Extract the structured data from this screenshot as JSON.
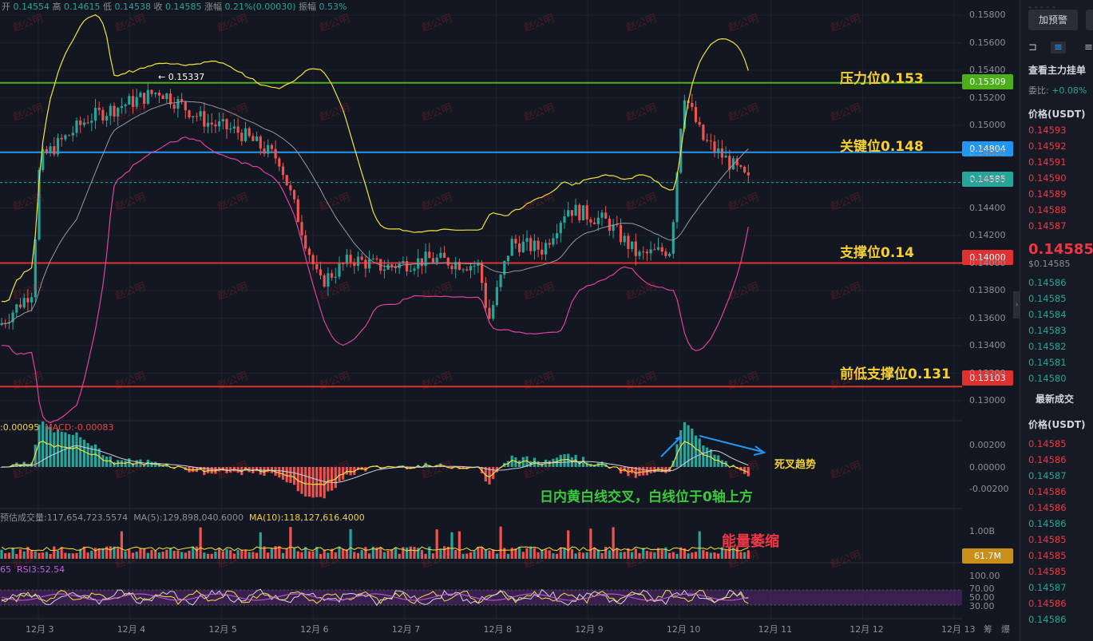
{
  "header": {
    "open_label": "开",
    "open": "0.14554",
    "high_label": "高",
    "high": "0.14615",
    "low_label": "低",
    "low": "0.14538",
    "close_label": "收",
    "close": "0.14585",
    "change_label": "涨幅",
    "change": "0.21%(0.00030)",
    "amp_label": "振幅",
    "amp": "0.53%"
  },
  "price_axis": [
    "0.15800",
    "0.15600",
    "0.15400",
    "0.15200",
    "0.15000",
    "0.14800",
    "0.14600",
    "0.14400",
    "0.14200",
    "0.14000",
    "0.13800",
    "0.13600",
    "0.13400",
    "0.13200",
    "0.13000"
  ],
  "levels": [
    {
      "label": "压力位0.153",
      "tag": "0.15309",
      "color": "#4caf1a"
    },
    {
      "label": "关键位0.148",
      "tag": "0.14804",
      "color": "#2196f3"
    },
    {
      "label": "支撑位0.14",
      "tag": "0.14000",
      "color": "#e03030"
    },
    {
      "label": "前低支撑位0.131",
      "tag": "0.13103",
      "color": "#e03030"
    }
  ],
  "current_tag": "0.14585",
  "high_marker": "← 0.15337",
  "macd": {
    "legend_a": ":0.00095",
    "legend_b": "MACD:-0.00083",
    "axis": [
      "0.00200",
      "0.00000",
      "-0.00200"
    ],
    "annotation": "日内黄白线交叉，白线位于0轴上方",
    "trend_label": "死叉趋势"
  },
  "volume": {
    "legend_a": "预估成交量:117,654,723.5574",
    "legend_b": "MA(5):129,898,040.6000",
    "legend_c": "MA(10):118,127,616.4000",
    "axis_top": "1.00B",
    "tag": "61.7M",
    "annotation": "能量萎缩"
  },
  "rsi": {
    "legend_a": "65",
    "legend_b": "RSI3:52.54",
    "axis": [
      "100.00",
      "70.00",
      "50.00",
      "30.00"
    ]
  },
  "x_axis": [
    "12月 3",
    "12月 4",
    "12月 5",
    "12月 6",
    "12月 7",
    "12月 8",
    "12月 9",
    "12月 10",
    "12月 11",
    "12月 12",
    "12月 13"
  ],
  "x_corner": [
    "筹",
    "爆"
  ],
  "watermark": "赵公明",
  "panel": {
    "dash": "- - - - -",
    "alert_button": "加预警",
    "view_orders": "查看主力挂单",
    "ratio_label": "委比:",
    "ratio": "+0.08%",
    "price_header": "价格(USDT)",
    "asks": [
      "0.14593",
      "0.14592",
      "0.14591",
      "0.14590",
      "0.14589",
      "0.14588",
      "0.14587"
    ],
    "last_price": "0.14585",
    "last_sub": "$0.14585",
    "bids": [
      "0.14586",
      "0.14585",
      "0.14584",
      "0.14583",
      "0.14582",
      "0.14581",
      "0.14580"
    ],
    "trades_title": "最新成交",
    "trades_header": "价格(USDT)",
    "trades": [
      {
        "p": "0.14585",
        "c": "r"
      },
      {
        "p": "0.14586",
        "c": "r"
      },
      {
        "p": "0.14587",
        "c": "g"
      },
      {
        "p": "0.14586",
        "c": "r"
      },
      {
        "p": "0.14586",
        "c": "r"
      },
      {
        "p": "0.14586",
        "c": "g"
      },
      {
        "p": "0.14585",
        "c": "r"
      },
      {
        "p": "0.14585",
        "c": "r"
      },
      {
        "p": "0.14585",
        "c": "r"
      },
      {
        "p": "0.14587",
        "c": "g"
      },
      {
        "p": "0.14586",
        "c": "r"
      },
      {
        "p": "0.14586",
        "c": "g"
      }
    ]
  }
}
